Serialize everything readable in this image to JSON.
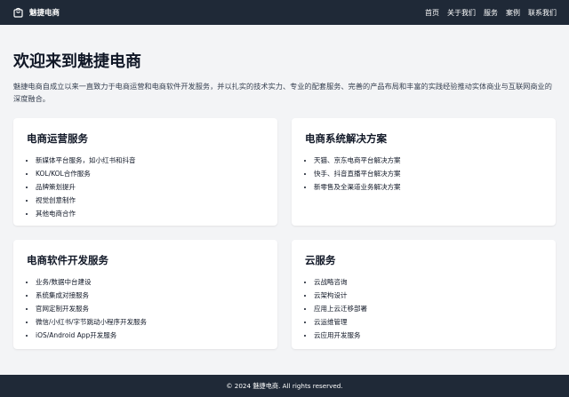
{
  "navbar": {
    "brand": "魅捷电商",
    "brand_icon": "shopping-bag-icon",
    "links": [
      "首页",
      "关于我们",
      "服务",
      "案例",
      "联系我们"
    ]
  },
  "hero": {
    "title": "欢迎来到魅捷电商",
    "description": "魅捷电商自成立以来一直致力于电商运营和电商软件开发服务，并以扎实的技术实力、专业的配套服务、完善的产品布局和丰富的实践经验推动实体商业与互联网商业的深度融合。"
  },
  "cards": [
    {
      "title": "电商运营服务",
      "items": [
        "新媒体平台服务，如小红书和抖音",
        "KOL/KOL合作服务",
        "品牌策划提升",
        "视觉创意制作",
        "其他电商合作"
      ]
    },
    {
      "title": "电商系统解决方案",
      "items": [
        "天猫、京东电商平台解决方案",
        "快手、抖音直播平台解决方案",
        "新零售及全渠道业务解决方案"
      ]
    },
    {
      "title": "电商软件开发服务",
      "items": [
        "业务/数据中台建设",
        "系统集成对接服务",
        "官网定制开发服务",
        "微信/小红书/字节跳动小程序开发服务",
        "iOS/Android App开发服务"
      ]
    },
    {
      "title": "云服务",
      "items": [
        "云战略咨询",
        "云架构设计",
        "应用上云迁移部署",
        "云运维管理",
        "云应用开发服务"
      ]
    }
  ],
  "footer": {
    "text": "© 2024 魅捷电商. All rights reserved."
  },
  "colors": {
    "navbar_bg": "#1f2937",
    "page_bg": "#f3f4f6",
    "card_bg": "#ffffff"
  }
}
